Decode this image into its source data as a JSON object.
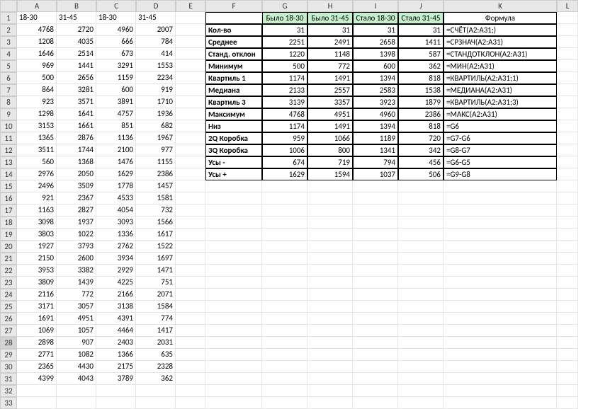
{
  "cols": [
    "A",
    "B",
    "C",
    "D",
    "E",
    "F",
    "G",
    "H",
    "I",
    "J",
    "K",
    "L"
  ],
  "rows": 33,
  "selectedRow": 28,
  "dataHeaders": [
    "18-30",
    "31-45",
    "18-30",
    "31-45"
  ],
  "dataTable": [
    [
      4768,
      2720,
      4960,
      2007
    ],
    [
      1208,
      4035,
      666,
      784
    ],
    [
      1646,
      2514,
      673,
      414
    ],
    [
      969,
      1441,
      3291,
      1553
    ],
    [
      500,
      2656,
      1159,
      2234
    ],
    [
      864,
      3281,
      600,
      919
    ],
    [
      923,
      3571,
      3891,
      1710
    ],
    [
      1298,
      1641,
      4757,
      1936
    ],
    [
      3153,
      1661,
      851,
      682
    ],
    [
      1365,
      2876,
      1136,
      1967
    ],
    [
      3511,
      1744,
      2100,
      977
    ],
    [
      560,
      1368,
      1476,
      1155
    ],
    [
      2976,
      2050,
      1629,
      2386
    ],
    [
      2496,
      3509,
      1778,
      1457
    ],
    [
      921,
      2367,
      4533,
      1581
    ],
    [
      1163,
      2827,
      4054,
      732
    ],
    [
      3098,
      1937,
      3093,
      1566
    ],
    [
      3803,
      1022,
      1336,
      1617
    ],
    [
      1927,
      3793,
      2762,
      1522
    ],
    [
      2150,
      2600,
      3934,
      1697
    ],
    [
      3953,
      3382,
      2929,
      1471
    ],
    [
      3809,
      1439,
      4225,
      751
    ],
    [
      2116,
      772,
      2166,
      2071
    ],
    [
      3171,
      3057,
      3138,
      1584
    ],
    [
      1691,
      4951,
      4391,
      774
    ],
    [
      1069,
      1057,
      4464,
      1417
    ],
    [
      2898,
      907,
      2403,
      2031
    ],
    [
      2771,
      1082,
      1366,
      635
    ],
    [
      2365,
      4430,
      2175,
      2328
    ],
    [
      4399,
      4043,
      3789,
      362
    ]
  ],
  "statsHeaders": [
    "Было 18-30",
    "Было 31-45",
    "Стало 18-30",
    "Стало 31-45"
  ],
  "formulaHeader": "Формула",
  "stats": [
    {
      "label": "Кол-во",
      "v": [
        31,
        31,
        31,
        31
      ],
      "formula": "=СЧЁТ(A2:A31;)"
    },
    {
      "label": "Среднее",
      "v": [
        2251,
        2491,
        2658,
        1411
      ],
      "formula": "=СРЗНАЧ(A2:A31)"
    },
    {
      "label": "Станд. отклон",
      "v": [
        1220,
        1148,
        1398,
        587
      ],
      "formula": "=СТАНДОТКЛОН(A2:A31)"
    },
    {
      "label": "Минимум",
      "v": [
        500,
        772,
        600,
        362
      ],
      "formula": "=МИН(A2:A31)"
    },
    {
      "label": "Квартиль 1",
      "v": [
        1174,
        1491,
        1394,
        818
      ],
      "formula": "=КВАРТИЛЬ(A2:A31;1)"
    },
    {
      "label": "Медиана",
      "v": [
        2133,
        2557,
        2583,
        1538
      ],
      "formula": "=МЕДИАНА(A2:A31)"
    },
    {
      "label": "Квартиль 3",
      "v": [
        3139,
        3357,
        3923,
        1879
      ],
      "formula": "=КВАРТИЛЬ(A2:A31;3)"
    },
    {
      "label": "Максимум",
      "v": [
        4768,
        4951,
        4960,
        2386
      ],
      "formula": "=МАКС(A2:A31)"
    },
    {
      "label": "Низ",
      "v": [
        1174,
        1491,
        1394,
        818
      ],
      "formula": "=G6"
    },
    {
      "label": "2Q Коробка",
      "v": [
        959,
        1066,
        1189,
        720
      ],
      "formula": "=G7-G6"
    },
    {
      "label": "3Q Коробка",
      "v": [
        1006,
        800,
        1341,
        342
      ],
      "formula": "=G8-G7"
    },
    {
      "label": "Усы -",
      "v": [
        674,
        719,
        794,
        456
      ],
      "formula": "=G6-G5"
    },
    {
      "label": "Усы +",
      "v": [
        1629,
        1594,
        1037,
        506
      ],
      "formula": "=G9-G8"
    }
  ]
}
